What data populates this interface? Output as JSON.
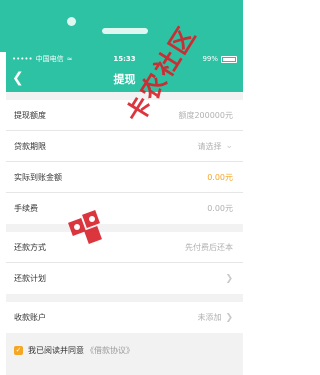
{
  "status": {
    "carrier": "中国电信",
    "time": "15:33",
    "battery": "99%",
    "battery_level": 0.99
  },
  "navbar": {
    "title": "提现"
  },
  "form": {
    "rows": [
      {
        "label": "提现额度",
        "value": "额度200000元"
      },
      {
        "label": "贷款期限",
        "value": "请选择"
      },
      {
        "label": "实际到账金额",
        "value": "0.00元"
      },
      {
        "label": "手续费",
        "value": "0.00元"
      },
      {
        "label": "还款方式",
        "value": "先付费后还本"
      },
      {
        "label": "还款计划",
        "value": ""
      },
      {
        "label": "收款账户",
        "value": "未添加"
      }
    ]
  },
  "agreement": {
    "text": "我已阅读并同意",
    "link": "《借款协议》"
  },
  "watermark": {
    "text": "卡农社区"
  },
  "colors": {
    "primary": "#2ec2a4",
    "accent": "#f5a623",
    "watermark": "#d8202a"
  }
}
